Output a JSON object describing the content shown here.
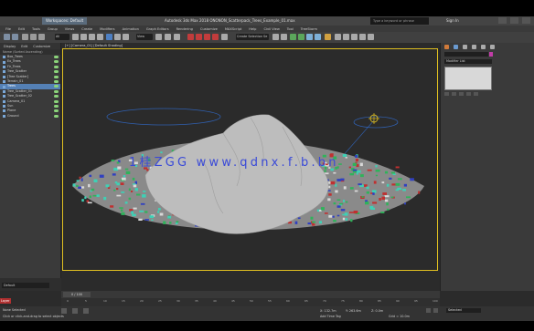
{
  "titlebar": {
    "workspace": "Workspaces: Default",
    "title": "Autodesk 3ds Max 2018    ONONON_Scatterpack_Trees_Example_01.max",
    "search_placeholder": "Type a keyword or phrase",
    "signin": "Sign In"
  },
  "menubar": [
    "File",
    "Edit",
    "Tools",
    "Group",
    "Views",
    "Create",
    "Modifiers",
    "Animation",
    "Graph Editors",
    "Rendering",
    "Customize",
    "MAXScript",
    "Help",
    "Civil View",
    "Tool",
    "TreeStorm"
  ],
  "toolbar": {
    "selection_filter": "All",
    "view_dropdown": "View",
    "named_selection": "Create Selection Se"
  },
  "scene_explorer": {
    "tabs": [
      "Display",
      "Edit",
      "Customize"
    ],
    "header": "Name (Sorted Ascending)",
    "rows": [
      {
        "label": "Box_Trees",
        "selected": false
      },
      {
        "label": "Ex_Trees",
        "selected": false
      },
      {
        "label": "Fir_Trees",
        "selected": false
      },
      {
        "label": "Tree_Scatter",
        "selected": false
      },
      {
        "label": "[Tree Scatter]",
        "selected": false
      },
      {
        "label": "Terrain_01",
        "selected": false
      },
      {
        "label": "Trees",
        "selected": true
      },
      {
        "label": "Tree_Scatter_01",
        "selected": false
      },
      {
        "label": "Tree_Scatter_02",
        "selected": false
      },
      {
        "label": "Camera_01",
        "selected": false
      },
      {
        "label": "Sun",
        "selected": false
      },
      {
        "label": "Plane",
        "selected": false
      },
      {
        "label": "Ground",
        "selected": false
      }
    ],
    "layer_field": "Default"
  },
  "viewport": {
    "label": "[+] [Camera_01] [Default Shading]",
    "watermark": "1桂ZGG  www.qdnx.f.b.bn"
  },
  "command_panel": {
    "modifier_list": "Modifier List"
  },
  "timeline": {
    "frame_indicator": "0 / 100",
    "ticks": [
      "0",
      "5",
      "10",
      "15",
      "20",
      "25",
      "30",
      "35",
      "40",
      "45",
      "50",
      "55",
      "60",
      "65",
      "70",
      "75",
      "80",
      "85",
      "90",
      "95",
      "100"
    ]
  },
  "status": {
    "message_1": "None Selected",
    "message_2": "Click or click-and-drag to select objects",
    "coord_x": "X: 132.7m",
    "coord_y": "Y: 263.6m",
    "coord_z": "Z: 0.0m",
    "grid": "Grid = 10.0m",
    "selected_dropdown": "Selected",
    "add_time_tag": "Add Time Tag",
    "layer_tab": "Layer"
  },
  "colors": {
    "accent_yellow": "#e0c020",
    "selection_blue": "#5480b5",
    "viewport_bg": "#2b2b2b",
    "terrain": "#b9b9b9",
    "trees_green": "#2fb35a",
    "trees_teal": "#3fd0b5",
    "trees_red": "#c03030",
    "trees_blue": "#3040c0",
    "watermark_blue": "#3a4ad8"
  }
}
